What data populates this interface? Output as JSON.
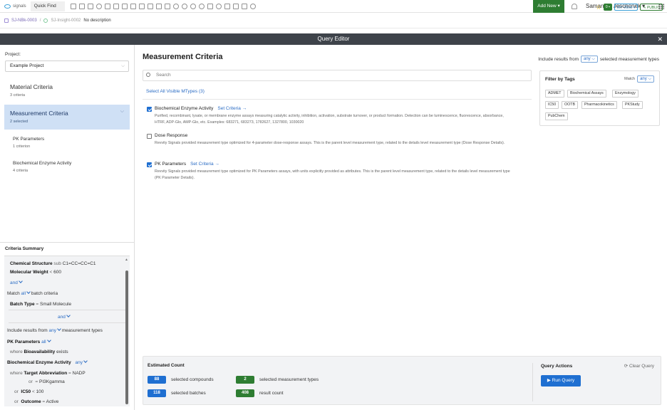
{
  "topbar": {
    "logo": "signals",
    "quickfind": "Quick Find",
    "add_new": "Add New ▾",
    "user": "Samantha Jeschonek ▾"
  },
  "breadcrumb": {
    "item1": "SJ-NBk-0003",
    "sep": "/",
    "item2": "SJ-Insight-0002",
    "desc": "No description",
    "badge_count": "0",
    "my_view": "MY VIEW ▾",
    "public": "PUBLIC"
  },
  "modal": {
    "title": "Query Editor",
    "close": "✕"
  },
  "left": {
    "project_label": "Project:",
    "project_value": "Example Project",
    "criteria": [
      {
        "title": "Material Criteria",
        "sub": "3 criteria"
      },
      {
        "title": "Measurement Criteria",
        "sub": "2 selected"
      }
    ],
    "subcriteria": [
      {
        "title": "PK Parameters",
        "sub": "1 criterion"
      },
      {
        "title": "Biochemical Enzyme Activity",
        "sub": "4 criteria"
      }
    ],
    "summary_title": "Criteria Summary",
    "summary": {
      "chem_label": "Chemical Structure",
      "chem_op": "sub",
      "chem_val": "C1=CC=CC=C1",
      "mw_label": "Molecular Weight",
      "mw_op": "<",
      "mw_val": "600",
      "and1": "and",
      "match": "Match",
      "all": "all",
      "batch_criteria": "batch criteria",
      "batch_label": "Batch Type",
      "batch_op": "=",
      "batch_val": "Small Molecule",
      "and2": "and",
      "include": "Include results from",
      "any": "any",
      "mtypes": "measurement types",
      "pk_label": "PK Parameters",
      "pk_all": "all",
      "where": "where",
      "bio_label": "Bioavailability",
      "exists": "exists",
      "bea_label": "Biochemical Enzyme Activity",
      "bea_any": "any",
      "where2": "where",
      "target_label": "Target Abbreviation",
      "target_op": "=",
      "target_val": "NADP",
      "or1": "or",
      "eq1": "=",
      "target_val2": "PI3Kgamma",
      "or2": "or",
      "ic50_label": "IC50",
      "ic50_op": "<",
      "ic50_val": "100",
      "or3": "or",
      "outcome_label": "Outcome",
      "outcome_op": "=",
      "outcome_val": "Active"
    }
  },
  "main": {
    "title": "Measurement Criteria",
    "include_prefix": "Include results from",
    "include_any": "any",
    "include_suffix": "selected measurement types",
    "search_placeholder": "Search",
    "select_all": "Select All Visible MTypes (3)",
    "mtypes": [
      {
        "title": "Biochemical Enzyme Activity",
        "set": "Set Criteria →",
        "checked": true,
        "desc": "Purified, recombinant, lysate, or membrane enzyme assays measuring catalytic activity, inhibition, activation, substrate turnover, or product formation. Detection can be luminescence, fluorescence, absorbance, HTRF, ADP-Glo, AMP-Glo, etc. Examples: 683271, 683273, 1782627, 1327800, 1030020"
      },
      {
        "title": "Dose Response",
        "set": "",
        "checked": false,
        "desc": "Revvity Signals provided measurement type optimized for 4-parameter dose-response assays. This is the parent level measurement type, related to the details level measurement type (Dose Response Details)."
      },
      {
        "title": "PK Parameters",
        "set": "Set Criteria →",
        "checked": true,
        "desc": "Revvity Signals provided measurement type optimized for PK Parameters assays, with units explicitly provided as attributes. This is the parent level measurement type, related to the details level measurement type (PK Parameter Details)."
      }
    ],
    "tags": {
      "title": "Filter by Tags",
      "match": "Match",
      "any": "any",
      "items": [
        "ADMET",
        "Biochemical Assays",
        "Enzymology",
        "IC50",
        "OOTB",
        "Pharmacokinetics",
        "PKStudy",
        "PubChem"
      ]
    },
    "footer": {
      "est_title": "Estimated Count",
      "compounds_count": "88",
      "compounds_label": "selected compounds",
      "mtypes_count": "2",
      "mtypes_label": "selected measurement types",
      "batches_count": "118",
      "batches_label": "selected batches",
      "results_count": "408",
      "results_label": "result count",
      "qa_title": "Query Actions",
      "clear": "Clear Query",
      "run": "▶  Run Query"
    }
  }
}
